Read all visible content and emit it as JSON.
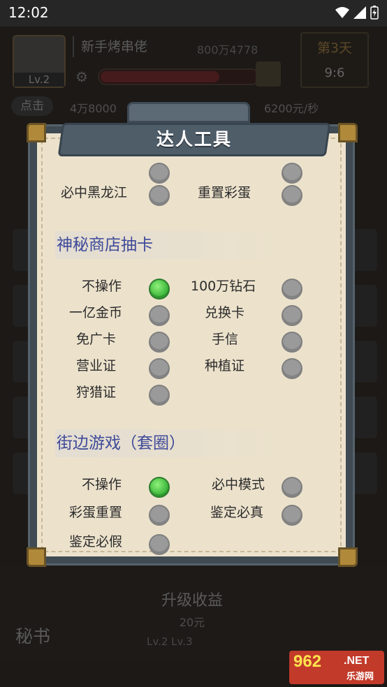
{
  "status_bar": {
    "time": "12:02"
  },
  "game": {
    "player_name": "新手烤串佬",
    "player_level": "Lv.2",
    "money_top": "800万4778",
    "day": "第3天",
    "clock": "9:6",
    "xp_fraction": 0.76,
    "click_button": "点击",
    "sub_money": "4万8000",
    "rate": "6200元/秒",
    "upgrade_title": "升级收益",
    "upgrade_cost": "20元",
    "upgrade_levels": "Lv.2    Lv.3",
    "secretary": "秘书"
  },
  "dialog": {
    "title": "达人工具",
    "top_row": [
      {
        "label": "必中黑龙江",
        "on": false
      },
      {
        "label": "重置彩蛋",
        "on": false
      }
    ],
    "sections": [
      {
        "title": "神秘商店抽卡",
        "options": [
          {
            "label": "不操作",
            "on": true
          },
          {
            "label": "100万钻石",
            "on": false
          },
          {
            "label": "一亿金币",
            "on": false
          },
          {
            "label": "兑换卡",
            "on": false
          },
          {
            "label": "免广卡",
            "on": false
          },
          {
            "label": "手信",
            "on": false
          },
          {
            "label": "营业证",
            "on": false
          },
          {
            "label": "种植证",
            "on": false
          },
          {
            "label": "狩猎证",
            "on": false
          }
        ]
      },
      {
        "title": "街边游戏（套圈）",
        "options": [
          {
            "label": "不操作",
            "on": true
          },
          {
            "label": "必中模式",
            "on": false
          },
          {
            "label": "彩蛋重置",
            "on": false
          },
          {
            "label": "鉴定必真",
            "on": false
          },
          {
            "label": "鉴定必假",
            "on": false
          }
        ]
      }
    ]
  },
  "watermark": {
    "brand": "962",
    "tld": ".NET",
    "site": "乐游网"
  }
}
